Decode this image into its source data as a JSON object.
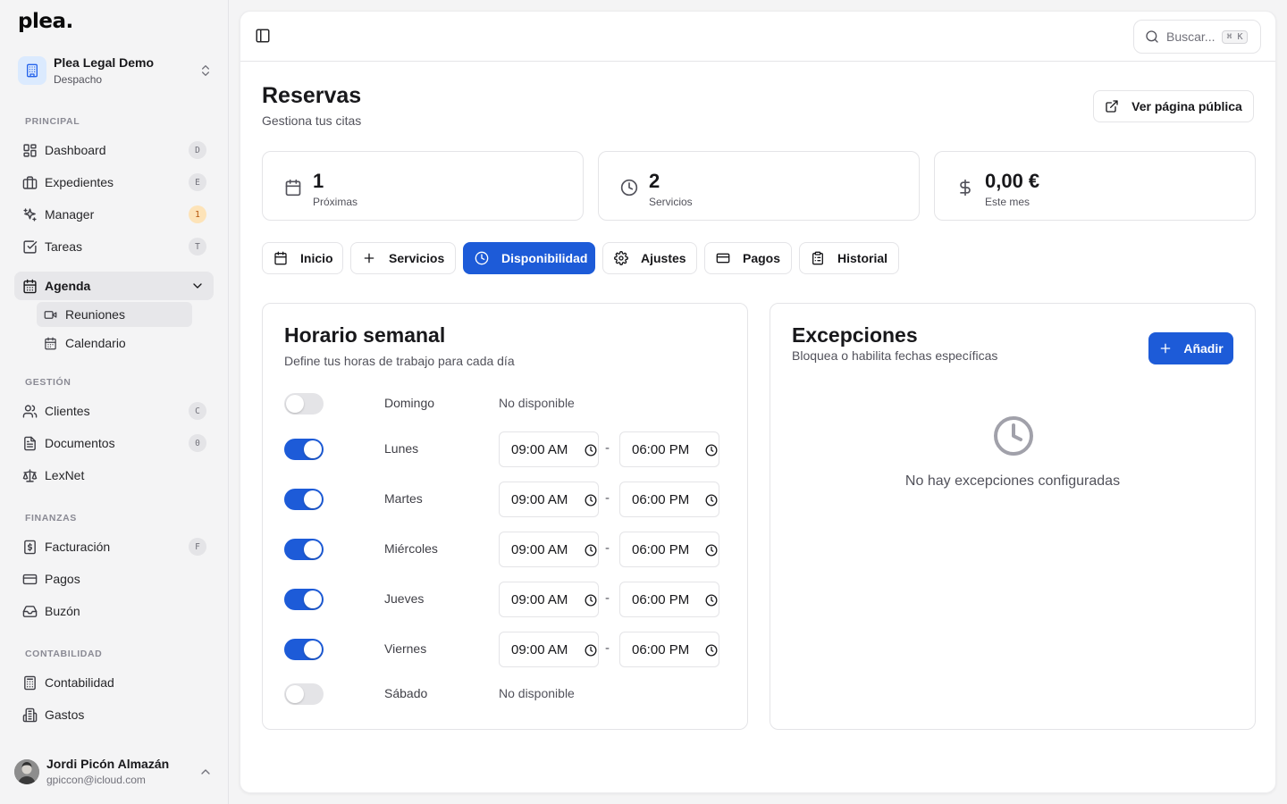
{
  "app": {
    "logo": "plea."
  },
  "org": {
    "name": "Plea Legal Demo",
    "subtitle": "Despacho"
  },
  "sidebar": {
    "sections": {
      "principal": "PRINCIPAL",
      "gestion": "GESTIÓN",
      "finanzas": "FINANZAS",
      "contabilidad": "CONTABILIDAD"
    },
    "items": {
      "dashboard": {
        "label": "Dashboard",
        "badge": "D"
      },
      "expedientes": {
        "label": "Expedientes",
        "badge": "E"
      },
      "manager": {
        "label": "Manager",
        "badge": "1"
      },
      "tareas": {
        "label": "Tareas",
        "badge": "T"
      },
      "agenda": {
        "label": "Agenda"
      },
      "reuniones": {
        "label": "Reuniones"
      },
      "calendario": {
        "label": "Calendario"
      },
      "clientes": {
        "label": "Clientes",
        "badge": "C"
      },
      "documentos": {
        "label": "Documentos",
        "badge": "0"
      },
      "lexnet": {
        "label": "LexNet"
      },
      "facturacion": {
        "label": "Facturación",
        "badge": "F"
      },
      "pagos": {
        "label": "Pagos"
      },
      "buzon": {
        "label": "Buzón"
      },
      "contabilidad": {
        "label": "Contabilidad"
      },
      "gastos": {
        "label": "Gastos"
      }
    }
  },
  "user": {
    "name": "Jordi Picón Almazán",
    "email": "gpiccon@icloud.com"
  },
  "topbar": {
    "search_placeholder": "Buscar...",
    "search_shortcut": "⌘ K"
  },
  "page": {
    "title": "Reservas",
    "subtitle": "Gestiona tus citas",
    "public_button": "Ver página pública"
  },
  "stats": [
    {
      "value": "1",
      "label": "Próximas",
      "icon": "calendar-icon"
    },
    {
      "value": "2",
      "label": "Servicios",
      "icon": "clock-icon"
    },
    {
      "value": "0,00 €",
      "label": "Este mes",
      "icon": "dollar-icon"
    }
  ],
  "tabs": {
    "inicio": "Inicio",
    "servicios": "Servicios",
    "disponibilidad": "Disponibilidad",
    "ajustes": "Ajustes",
    "pagos": "Pagos",
    "historial": "Historial",
    "active": "disponibilidad"
  },
  "schedule": {
    "title": "Horario semanal",
    "subtitle": "Define tus horas de trabajo para cada día",
    "unavailable_label": "No disponible",
    "separator": "-",
    "days": [
      {
        "name": "Domingo",
        "enabled": false
      },
      {
        "name": "Lunes",
        "enabled": true,
        "start": "09:00 AM",
        "end": "06:00 PM"
      },
      {
        "name": "Martes",
        "enabled": true,
        "start": "09:00 AM",
        "end": "06:00 PM"
      },
      {
        "name": "Miércoles",
        "enabled": true,
        "start": "09:00 AM",
        "end": "06:00 PM"
      },
      {
        "name": "Jueves",
        "enabled": true,
        "start": "09:00 AM",
        "end": "06:00 PM"
      },
      {
        "name": "Viernes",
        "enabled": true,
        "start": "09:00 AM",
        "end": "06:00 PM"
      },
      {
        "name": "Sábado",
        "enabled": false
      }
    ]
  },
  "exceptions": {
    "title": "Excepciones",
    "subtitle": "Bloquea o habilita fechas específicas",
    "add_button": "Añadir",
    "empty_text": "No hay excepciones configuradas"
  },
  "colors": {
    "accent": "#1d5bd8",
    "border": "#e4e4e7",
    "muted_text": "#52525b"
  }
}
